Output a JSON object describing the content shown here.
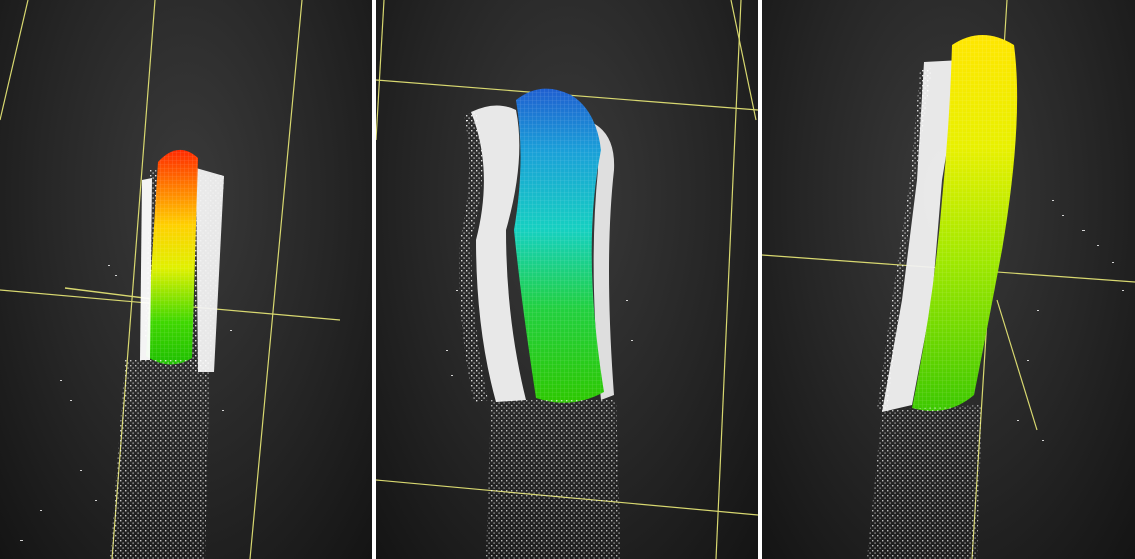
{
  "figure": {
    "panels": [
      {
        "id": "view-1",
        "mesh_color_top": "#ff2a00",
        "mesh_color_mid": "#f0f000",
        "mesh_color_bottom": "#22cc00"
      },
      {
        "id": "view-2",
        "mesh_color_top": "#1f6fd6",
        "mesh_color_mid": "#14c8c8",
        "mesh_color_bottom": "#2dd000"
      },
      {
        "id": "view-3",
        "mesh_color_top": "#ffe600",
        "mesh_color_mid": "#c8ee00",
        "mesh_color_bottom": "#44cc00"
      }
    ],
    "colors": {
      "background": "#262626",
      "point_cloud": "#ffffff",
      "guide_lines": "#d8d870",
      "separator": "#ffffff"
    }
  }
}
